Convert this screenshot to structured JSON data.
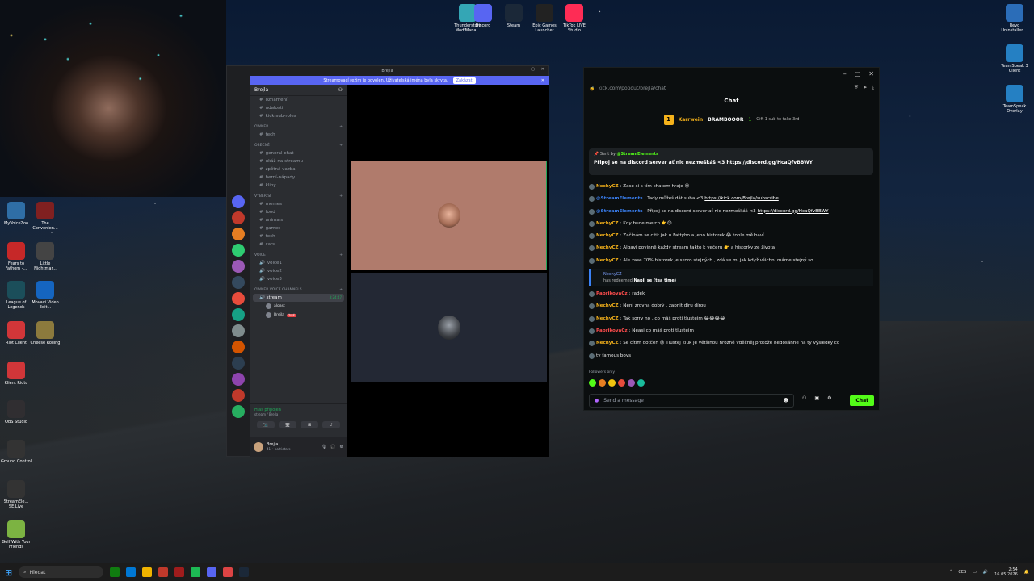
{
  "desktop": {
    "top_icons": [
      {
        "label": "Thunderstore Mod Mana...",
        "icon": "thunderstore-icon",
        "color": "#34a6b5"
      },
      {
        "label": "Discord",
        "icon": "discord-icon",
        "color": "#5865f2"
      },
      {
        "label": "Steam",
        "icon": "steam-icon",
        "color": "#1b2838"
      },
      {
        "label": "Epic Games Launcher",
        "icon": "epic-games-icon",
        "color": "#222"
      },
      {
        "label": "TikTok LIVE Studio",
        "icon": "tiktok-icon",
        "color": "#fe2c55"
      }
    ],
    "left_icons": [
      {
        "label": "MyVoiceZoo",
        "icon": "voice-icon",
        "color": "#2f6ea6"
      },
      {
        "label": "The Convenien...",
        "icon": "game-icon",
        "color": "#802020"
      },
      {
        "label": "Fears to Fathom -...",
        "icon": "f2f-icon",
        "color": "#c62828"
      },
      {
        "label": "Little Nightmar...",
        "icon": "nightmare-icon",
        "color": "#444"
      },
      {
        "label": "League of Legends",
        "icon": "lol-icon",
        "color": "#1b4e5a"
      },
      {
        "label": "Movavi Video Edit...",
        "icon": "movavi-icon",
        "color": "#1565c0"
      },
      {
        "label": "Riot Client",
        "icon": "riot-icon",
        "color": "#d13639"
      },
      {
        "label": "Cheese Rolling",
        "icon": "cheese-icon",
        "color": "#8c7a3d"
      },
      {
        "label": "Klient Riotu",
        "icon": "riot-icon",
        "color": "#d13639"
      },
      {
        "label": "OBS Studio",
        "icon": "obs-icon",
        "color": "#302e31"
      },
      {
        "label": "Ground Control",
        "icon": "ground-control-icon",
        "color": "#333"
      },
      {
        "label": "StreamEle... SE.Live",
        "icon": "streamelements-icon",
        "color": "#333"
      },
      {
        "label": "Golf With Your Friends",
        "icon": "golf-icon",
        "color": "#7cb342"
      }
    ],
    "right_icons": [
      {
        "label": "Revo Uninstaller ...",
        "icon": "revo-icon",
        "color": "#2b6db8"
      },
      {
        "label": "TeamSpeak 3 Client",
        "icon": "teamspeak-icon",
        "color": "#2580c3"
      },
      {
        "label": "TeamSpeak Overlay",
        "icon": "teamspeak-icon",
        "color": "#2580c3"
      }
    ]
  },
  "discord": {
    "window_title": "Brejla",
    "banner_text": "Streamovací režim je povolen. Uživatelská jména byla skryta.",
    "banner_button": "Zakázat",
    "guild_name": "Brejla",
    "channels_top": [
      "oznámení",
      "udalosti",
      "kick-sub-roles"
    ],
    "categories": [
      {
        "name": "OWNER",
        "channels": [
          {
            "name": "tech",
            "icon": "#"
          }
        ]
      },
      {
        "name": "OBECNÉ",
        "channels": [
          {
            "name": "general-chat",
            "icon": "#"
          },
          {
            "name": "ukáž-na-streamu",
            "icon": "#"
          },
          {
            "name": "zpětná-vazba",
            "icon": "#"
          },
          {
            "name": "herní-nápady",
            "icon": "#"
          },
          {
            "name": "klipy",
            "icon": "#"
          }
        ]
      },
      {
        "name": "VYBER SI",
        "channels": [
          {
            "name": "memes",
            "icon": "#"
          },
          {
            "name": "food",
            "icon": "#"
          },
          {
            "name": "animals",
            "icon": "#"
          },
          {
            "name": "games",
            "icon": "#"
          },
          {
            "name": "tech",
            "icon": "#"
          },
          {
            "name": "cars",
            "icon": "#"
          }
        ]
      },
      {
        "name": "VOICE",
        "channels": [
          {
            "name": "voice1",
            "icon": "🔊"
          },
          {
            "name": "voice2",
            "icon": "🔊"
          },
          {
            "name": "voice3",
            "icon": "🔊"
          }
        ]
      },
      {
        "name": "OWNER VOICE CHANNELS",
        "channels": []
      }
    ],
    "active_voice": {
      "name": "stream",
      "timer": "3:24:47",
      "users": [
        "algast",
        "Brejla"
      ],
      "badge": "ŽIVĚ"
    },
    "voice_status": "Hlas připojen",
    "voice_sub": "stream / Brejla",
    "user_name": "Brejla",
    "user_sub": "41 • patriotars"
  },
  "kick": {
    "url": "kick.com/popout/brejla/chat",
    "header": "Chat",
    "gift": {
      "badge": "1",
      "user": "Karrwein",
      "target": "BRAMBOOOR",
      "count": "1",
      "subtext": "Gift 1 sub to take 3rd"
    },
    "pinned": {
      "by_label": "Sent by",
      "by_user": "@StreamElements",
      "text": "Připoj se na discord server ať nic nezmeškáš <3 ",
      "link": "https://discord.gg/HcaQfvBBWY"
    },
    "messages": [
      {
        "user": "NechyCZ",
        "color": "#f5b21b",
        "text": ": Zase si s tím chatem hraje 😔"
      },
      {
        "user": "@StreamElements",
        "color": "#3b82f6",
        "text": ": Tady můžeš dát suba <3 ",
        "link": "https://kick.com/Brejla/subscribe"
      },
      {
        "user": "@StreamElements",
        "color": "#3b82f6",
        "text": ": Připoj se na discord server ať nic nezmeškáš <3 ",
        "link": "https://discord.gg/HcaQfvBBWY"
      },
      {
        "user": "NechyCZ",
        "color": "#f5b21b",
        "text": ": Kdy bude merch 👉😊"
      },
      {
        "user": "NechyCZ",
        "color": "#f5b21b",
        "text": ": Začínám se cítit jak u Fattyho a jeho historek 😂 tohle mě baví"
      },
      {
        "user": "NechyCZ",
        "color": "#f5b21b",
        "text": ": Algavi povinně každý stream takto k večeru 👉 a historky ze života"
      },
      {
        "user": "NechyCZ",
        "color": "#f5b21b",
        "text": ": Ale zase 70% historek je skoro stejných , zdá se mi jak když všichni máme stejný so"
      }
    ],
    "raid": {
      "user": "NechyCZ",
      "text": "has redeemed ",
      "reward": "Napij se (tea time)"
    },
    "messages2": [
      {
        "user": "PaprikovaCz",
        "color": "#ff4d4d",
        "text": ": radek"
      },
      {
        "user": "NechyCZ",
        "color": "#f5b21b",
        "text": ": Není zrovna dobrý , zapnit diru dírou"
      },
      {
        "user": "NechyCZ",
        "color": "#f5b21b",
        "text": ": Tak sorry no , co máš proti tlustejm 😂😂😂😂"
      },
      {
        "user": "PaprikovaCz",
        "color": "#ff4d4d",
        "text": ": Neasi co máš proti tlustejm"
      },
      {
        "user": "NechyCZ",
        "color": "#f5b21b",
        "text": ": Se cítím dotčen 😢 Tlustej kluk je většinou hrozně vděčněj protože nedosáhne na ty výsledky co"
      },
      {
        "user": "",
        "color": "#f5b21b",
        "text": "ty famous boys"
      }
    ],
    "followers_only": "Followers only",
    "input_placeholder": "Send a message",
    "chat_button": "Chat"
  },
  "taskbar": {
    "search": "Hledat",
    "lang": "CES",
    "time": "2:54",
    "date": "16.05.2026"
  }
}
